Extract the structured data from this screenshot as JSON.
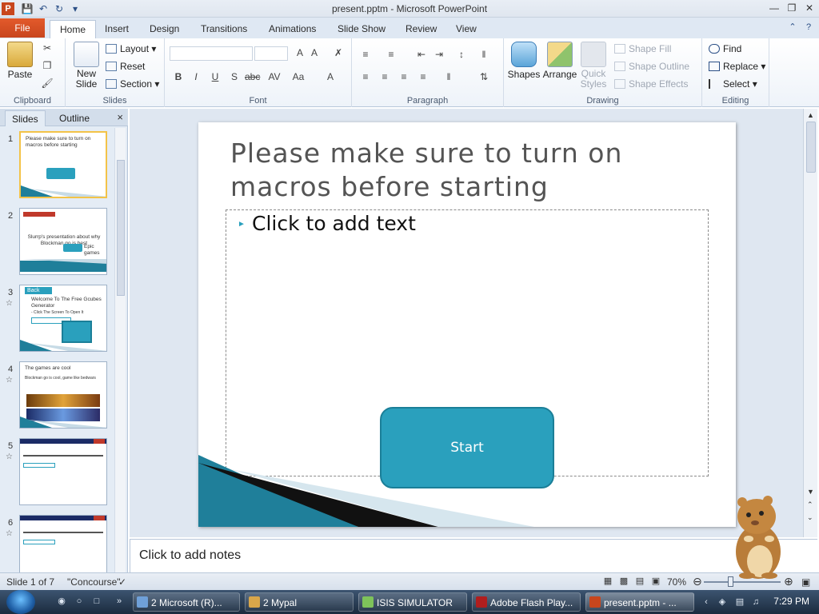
{
  "window": {
    "title": "present.pptm  -  Microsoft PowerPoint",
    "app_icon": "P"
  },
  "ribbon_tabs": {
    "file": "File",
    "tabs": [
      "Home",
      "Insert",
      "Design",
      "Transitions",
      "Animations",
      "Slide Show",
      "Review",
      "View"
    ],
    "active": "Home"
  },
  "ribbon": {
    "clipboard": {
      "label": "Clipboard",
      "paste": "Paste"
    },
    "slides": {
      "label": "Slides",
      "new_slide": "New Slide",
      "new_slide_line1": "New",
      "new_slide_line2": "Slide",
      "layout": "Layout",
      "reset": "Reset",
      "section": "Section"
    },
    "font": {
      "label": "Font"
    },
    "paragraph": {
      "label": "Paragraph"
    },
    "drawing": {
      "label": "Drawing",
      "shapes": "Shapes",
      "arrange": "Arrange",
      "quick_styles_line1": "Quick",
      "quick_styles_line2": "Styles",
      "shape_fill": "Shape Fill",
      "shape_outline": "Shape Outline",
      "shape_effects": "Shape Effects"
    },
    "editing": {
      "label": "Editing",
      "find": "Find",
      "replace": "Replace",
      "select": "Select"
    }
  },
  "panel": {
    "tab_slides": "Slides",
    "tab_outline": "Outline",
    "close": "×",
    "thumbnails": [
      {
        "num": "1",
        "text": "Please make sure to turn on macros before starting",
        "button": "Start",
        "selected": true,
        "animated": false
      },
      {
        "num": "2",
        "text": "Slurrp's presentation about why Blockman go is best",
        "caption": "Epic games",
        "selected": false,
        "animated": false
      },
      {
        "num": "3",
        "text": "Welcome To The Free Gcubes Generator",
        "sub": "- Click The Screen To Open It",
        "header": "Back",
        "selected": false,
        "animated": true
      },
      {
        "num": "4",
        "text": "The games are cool",
        "sub": "Blockman go is cool, game like bedwars",
        "selected": false,
        "animated": true
      },
      {
        "num": "5",
        "text": "",
        "selected": false,
        "animated": true
      },
      {
        "num": "6",
        "text": "",
        "selected": false,
        "animated": true
      }
    ]
  },
  "slide": {
    "title": "Please make sure to turn on macros before starting",
    "placeholder": "Click to add text",
    "button_label": "Start"
  },
  "notes": {
    "placeholder": "Click to add notes"
  },
  "status": {
    "slide_info": "Slide 1 of 7",
    "theme": "\"Concourse\"",
    "zoom": "70%",
    "zoom_fraction": 0.7
  },
  "taskbar": {
    "items": [
      {
        "label": "2 Microsoft (R)...",
        "color": "#6fa0d8"
      },
      {
        "label": "2 Mypal",
        "color": "#d8a64a"
      },
      {
        "label": "ISIS SIMULATOR",
        "color": "#7ec35a"
      },
      {
        "label": "Adobe Flash Play...",
        "color": "#b01e1e"
      },
      {
        "label": "present.pptm - ...",
        "color": "#c8461d"
      }
    ],
    "active": "present.pptm - ...",
    "clock": "7:29 PM"
  },
  "colors": {
    "accent": "#2aa0bd",
    "file_tab": "#c8461d",
    "selected_thumb": "#f3c348"
  },
  "icons": [
    "paste-icon",
    "cut-icon",
    "copy-icon",
    "format-painter-icon",
    "new-slide-icon",
    "layout-icon",
    "reset-icon",
    "section-icon",
    "bold-icon",
    "italic-icon",
    "underline-icon",
    "shapes-icon",
    "arrange-icon",
    "quick-styles-icon",
    "find-icon",
    "replace-icon",
    "select-icon",
    "help-icon",
    "minimize-icon",
    "maximize-icon",
    "close-icon"
  ]
}
